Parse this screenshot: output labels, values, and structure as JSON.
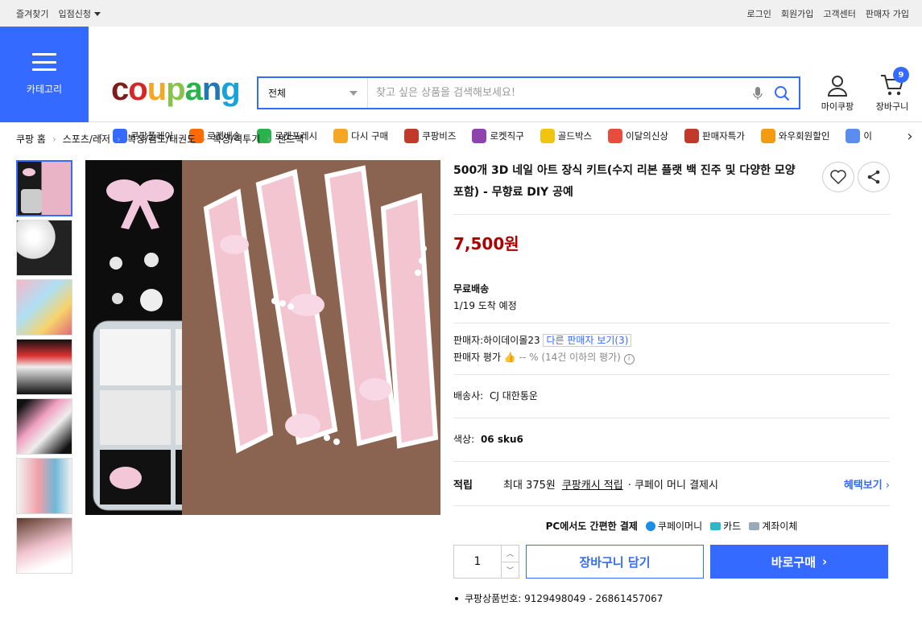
{
  "topbar": {
    "bookmark": "즐겨찾기",
    "seller_apply": "입점신청",
    "login": "로그인",
    "signup": "회원가입",
    "customer_center": "고객센터",
    "seller_signup": "판매자 가입"
  },
  "header": {
    "category_label": "카테고리",
    "logo_text": "coupang",
    "search_scope": "전체",
    "search_placeholder": "찾고 싶은 상품을 검색해보세요!",
    "mycoupang": "마이쿠팡",
    "cart_label": "장바구니",
    "cart_count": "9"
  },
  "nav_strip": [
    {
      "label": "쿠팡플레이",
      "icon": "play-icon",
      "color": "#346aff"
    },
    {
      "label": "로켓배송",
      "icon": "rocket-icon",
      "color": "#ff6b00"
    },
    {
      "label": "로켓프레시",
      "icon": "rocket-fresh-icon",
      "color": "#2bb24c"
    },
    {
      "label": "다시 구매",
      "icon": "rebuy-icon",
      "color": "#f5a623"
    },
    {
      "label": "쿠팡비즈",
      "icon": "biz-icon",
      "color": "#c0392b"
    },
    {
      "label": "로켓직구",
      "icon": "global-icon",
      "color": "#8e44ad"
    },
    {
      "label": "골드박스",
      "icon": "goldbox-icon",
      "color": "#f1c40f"
    },
    {
      "label": "이달의신상",
      "icon": "new-icon",
      "color": "#e74c3c"
    },
    {
      "label": "판매자특가",
      "icon": "percent-icon",
      "color": "#c0392b"
    },
    {
      "label": "와우회원할인",
      "icon": "wow-icon",
      "color": "#f39c12"
    },
    {
      "label": "이",
      "icon": "coupon-icon",
      "color": "#5b8def"
    }
  ],
  "breadcrumb": [
    "쿠팡 홈",
    "스포츠/레저",
    "복싱/검도/태권도",
    "복싱/격투기",
    "샌드백"
  ],
  "product": {
    "title": "500개 3D 네일 아트 장식 키트(수지 리본 플랫 백 진주 및 다양한 모양 포함) - 무향료 DIY 공예",
    "price": "7,500원",
    "shipping_title": "무료배송",
    "arrival": "1/19 도착 예정",
    "seller_label": "판매자:",
    "seller_name": "하이데이몰23",
    "other_sellers": "다른 판매자 보기(3)",
    "seller_rating_label": "판매자 평가",
    "seller_rating_value": "-- % (14건 이하의 평가)",
    "courier_label": "배송사:",
    "courier": "CJ 대한통운",
    "color_label": "색상:",
    "color_value": "06 sku6",
    "reward_label": "적립",
    "reward_max": "최대 375원",
    "reward_cash": "쿠팡캐시 적립",
    "reward_desc": "· 쿠페이 머니 결제시",
    "reward_link": "혜택보기",
    "pay_title": "PC에서도 간편한 결제",
    "pay_money": "쿠페이머니",
    "pay_card": "카드",
    "pay_account": "계좌이체",
    "quantity": "1",
    "add_to_cart": "장바구니 담기",
    "buy_now": "바로구매",
    "product_no": "쿠팡상품번호: 9129498049 - 26861457067"
  }
}
